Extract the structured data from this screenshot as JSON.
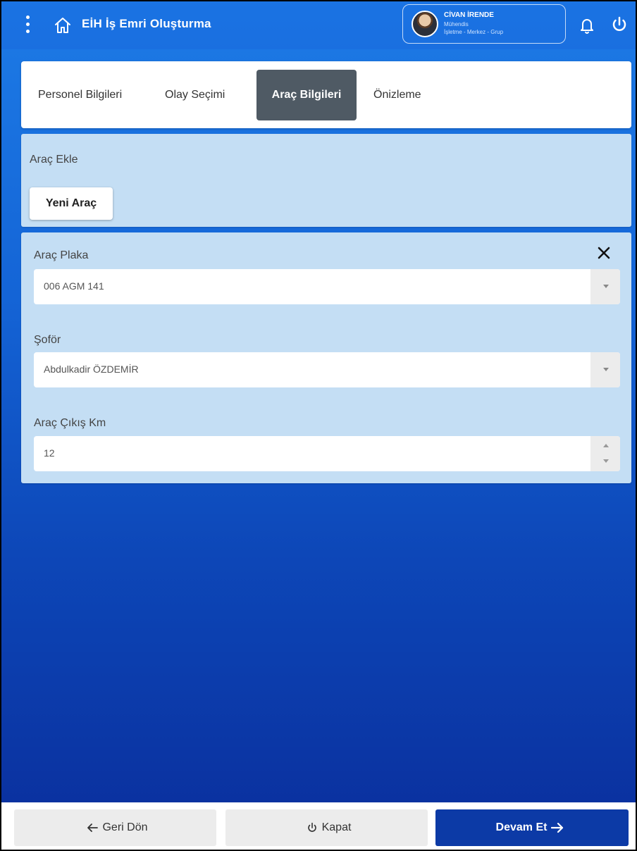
{
  "header": {
    "title": "EİH İş Emri Oluşturma",
    "user_name": "CİVAN İRENDE",
    "user_role": "Mühendis",
    "user_org": "İşletme - Merkez - Grup"
  },
  "tabs": [
    {
      "label": "Personel Bilgileri",
      "active": false
    },
    {
      "label": "Olay Seçimi",
      "active": false
    },
    {
      "label": "Araç Bilgileri",
      "active": true
    },
    {
      "label": "Önizleme",
      "active": false
    }
  ],
  "add_panel": {
    "label": "Araç Ekle",
    "new_button": "Yeni Araç"
  },
  "vehicle_form": {
    "plate_label": "Araç Plaka",
    "plate_value": "006 AGM 141",
    "driver_label": "Şoför",
    "driver_value": "Abdulkadir ÖZDEMİR",
    "km_label": "Araç Çıkış Km",
    "km_value": "12"
  },
  "footer": {
    "back_label": "Geri Dön",
    "close_label": "Kapat",
    "next_label": "Devam Et"
  },
  "colors": {
    "primary": "#0c3aa6",
    "topbar": "#1a73e3",
    "panel": "#c4def4",
    "active_tab": "#4f5a64"
  }
}
